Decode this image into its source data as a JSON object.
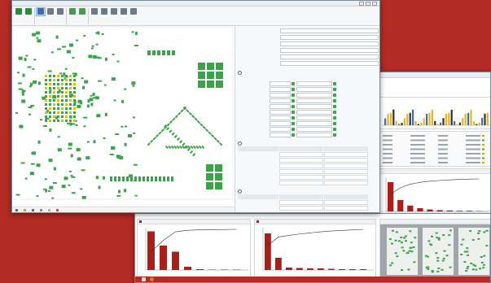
{
  "front": {
    "title": "",
    "ribbon": [
      {
        "label": "",
        "color": "#2e8b3a"
      },
      {
        "label": "",
        "color": "#2e8b3a"
      },
      {
        "label": "",
        "color": "#3c6fb0"
      },
      {
        "label": "",
        "color": "#6a7a8a"
      },
      {
        "label": "",
        "color": "#6a7a8a"
      },
      {
        "label": "",
        "color": "#4a9a4a"
      },
      {
        "label": "",
        "color": "#4a9a4a"
      },
      {
        "label": "",
        "color": "#6a7a8a"
      },
      {
        "label": "",
        "color": "#6a7a8a"
      },
      {
        "label": "",
        "color": "#6a7a8a"
      },
      {
        "label": "",
        "color": "#6a7a8a"
      },
      {
        "label": "",
        "color": "#6a7a8a"
      }
    ],
    "brand": "",
    "status_items": [
      {
        "label": "",
        "color": "#2e8b3a"
      },
      {
        "label": "",
        "color": "#d9a600"
      },
      {
        "label": "",
        "color": "#3c6fb0"
      },
      {
        "label": "",
        "color": "#888888"
      },
      {
        "label": "",
        "color": "#b0b0b0"
      },
      {
        "label": "",
        "color": "#c94a4a"
      }
    ],
    "props_top": [
      {
        "key": "",
        "value": ""
      },
      {
        "key": "",
        "value": ""
      },
      {
        "key": "",
        "value": ""
      },
      {
        "key": "",
        "value": ""
      },
      {
        "key": "",
        "value": ""
      },
      {
        "key": "",
        "value": ""
      }
    ],
    "section1": {
      "title": "",
      "col1": "",
      "col2": "",
      "rows": [
        {
          "k": "",
          "a": "",
          "b": ""
        },
        {
          "k": "",
          "a": "",
          "b": ""
        },
        {
          "k": "",
          "a": "",
          "b": ""
        },
        {
          "k": "",
          "a": "",
          "b": ""
        },
        {
          "k": "",
          "a": "",
          "b": ""
        },
        {
          "k": "",
          "a": "",
          "b": ""
        },
        {
          "k": "",
          "a": "",
          "b": ""
        },
        {
          "k": "",
          "a": "",
          "b": ""
        },
        {
          "k": "",
          "a": "",
          "b": ""
        },
        {
          "k": "",
          "a": "",
          "b": ""
        }
      ]
    },
    "section2": {
      "title": "",
      "col1": "",
      "col2": "",
      "rows": [
        {
          "k": "",
          "a": "",
          "b": ""
        },
        {
          "k": "",
          "a": "",
          "b": ""
        },
        {
          "k": "",
          "a": "",
          "b": ""
        },
        {
          "k": "",
          "a": "",
          "b": ""
        },
        {
          "k": "",
          "a": "",
          "b": ""
        },
        {
          "k": "",
          "a": "",
          "b": ""
        }
      ]
    },
    "section3": {
      "title": "",
      "col1": "",
      "col2": "",
      "rows": [
        {
          "k": "",
          "a": "",
          "b": ""
        },
        {
          "k": "",
          "a": "",
          "b": ""
        }
      ]
    }
  },
  "colors": {
    "background": "#b42a24",
    "pad": "#3aa548",
    "bar_primary": "#a8201a",
    "bar_secondary": "#e8b320",
    "accent_blue": "#3c6fb0"
  }
}
